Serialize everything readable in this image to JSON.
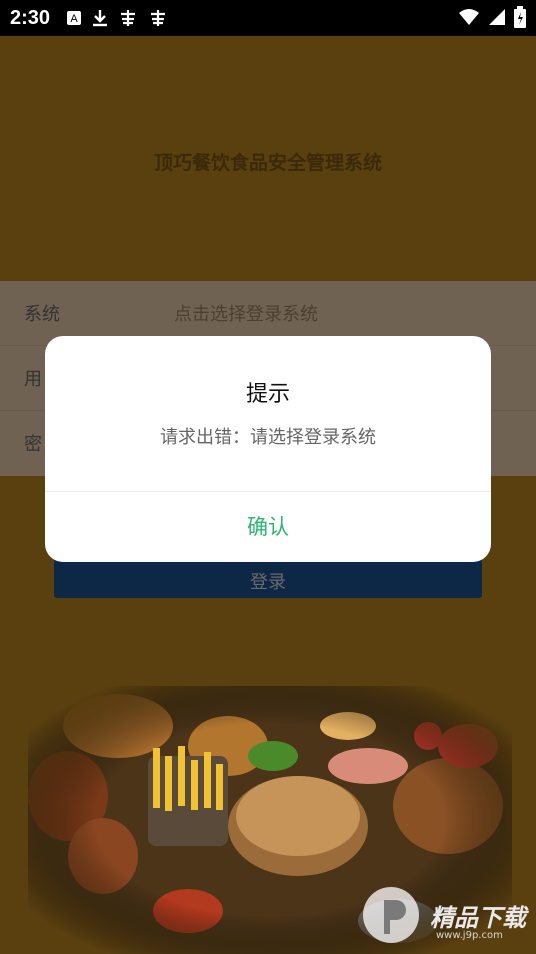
{
  "status_bar": {
    "time": "2:30"
  },
  "app": {
    "title": "顶巧餐饮食品安全管理系统",
    "form": {
      "system_label": "系统",
      "system_placeholder": "点击选择登录系统",
      "user_label_visible": "用",
      "password_label_visible": "密"
    },
    "login_button_label": "登录"
  },
  "dialog": {
    "title": "提示",
    "message": "请求出错：请选择登录系统",
    "confirm_label": "确认"
  },
  "watermark": {
    "text": "精品下载",
    "url": "www.j9p.com"
  },
  "colors": {
    "background": "#5a3f0f",
    "dialog_button": "#2bb573",
    "login_button": "#0d2746"
  }
}
